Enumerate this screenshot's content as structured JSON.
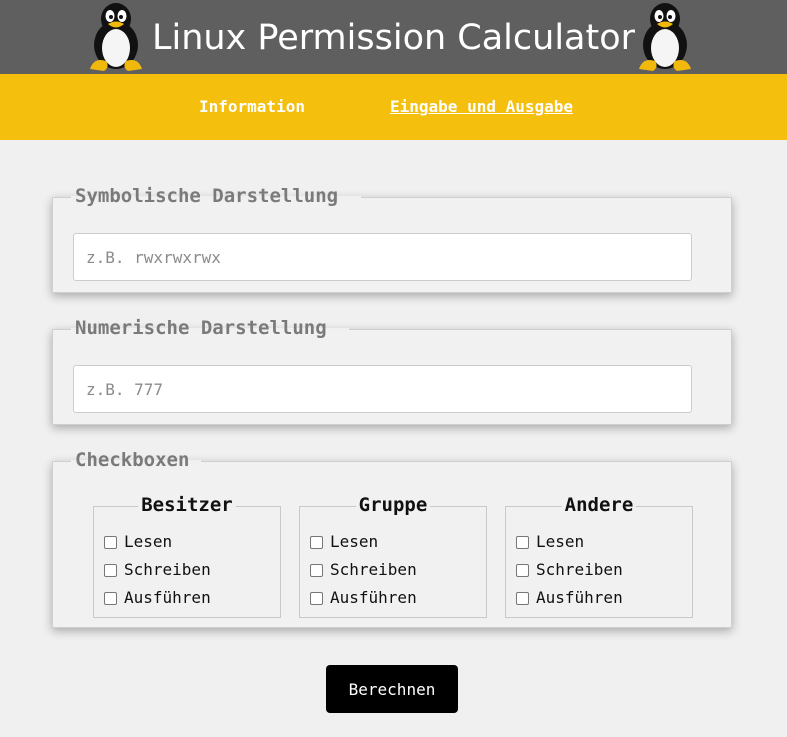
{
  "header": {
    "title": "Linux Permission Calculator",
    "logo_left": "tux-penguin-icon",
    "logo_right": "tux-penguin-icon",
    "background": "#5f5f5f"
  },
  "nav": {
    "items": [
      {
        "label": "Information"
      },
      {
        "label": "Eingabe und Ausgabe"
      }
    ],
    "background": "#f4bf0d"
  },
  "symbolic": {
    "legend": "Symbolische Darstellung",
    "value": "",
    "placeholder": "z.B. rwxrwxrwx"
  },
  "numeric": {
    "legend": "Numerische Darstellung",
    "value": "",
    "placeholder": "z.B. 777"
  },
  "checkboxes": {
    "legend": "Checkboxen",
    "groups": [
      {
        "title": "Besitzer",
        "options": [
          {
            "label": "Lesen",
            "checked": false
          },
          {
            "label": "Schreiben",
            "checked": false
          },
          {
            "label": "Ausführen",
            "checked": false
          }
        ]
      },
      {
        "title": "Gruppe",
        "options": [
          {
            "label": "Lesen",
            "checked": false
          },
          {
            "label": "Schreiben",
            "checked": false
          },
          {
            "label": "Ausführen",
            "checked": false
          }
        ]
      },
      {
        "title": "Andere",
        "options": [
          {
            "label": "Lesen",
            "checked": false
          },
          {
            "label": "Schreiben",
            "checked": false
          },
          {
            "label": "Ausführen",
            "checked": false
          }
        ]
      }
    ]
  },
  "actions": {
    "calculate_label": "Berechnen"
  }
}
